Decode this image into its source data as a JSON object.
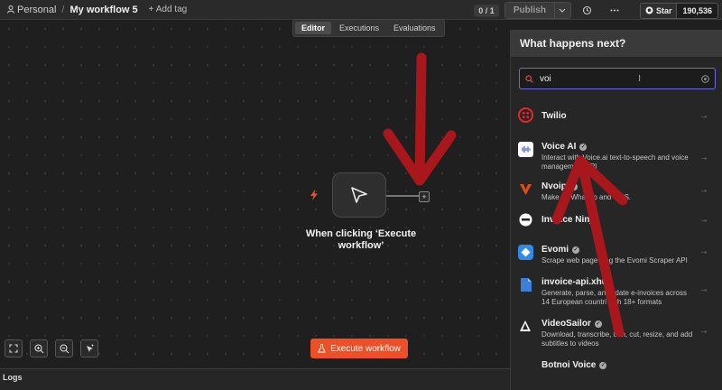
{
  "header": {
    "project": "Personal",
    "separator": "/",
    "workflow_name": "My workflow 5",
    "add_tag": "+ Add tag",
    "counter": "0 / 1",
    "publish": "Publish",
    "github_star": "Star",
    "github_count": "190,536"
  },
  "tabs": [
    "Editor",
    "Executions",
    "Evaluations"
  ],
  "canvas": {
    "trigger_label": "When clicking ‘Execute workflow’",
    "execute_button": "Execute workflow",
    "logs": "Logs"
  },
  "panel": {
    "title": "What happens next?",
    "search_value": "voi",
    "items": [
      {
        "name": "Twilio",
        "desc": "",
        "verified": false,
        "icon_color": "#e5262e",
        "icon": "twilio-icon"
      },
      {
        "name": "Voice AI",
        "desc": "Interact with Voice.ai text-to-speech and voice management API",
        "verified": true,
        "icon_color": "#ffffff",
        "icon": "voice-ai-icon"
      },
      {
        "name": "Nvoip",
        "desc": "Make ca         Whats    p and SMS.",
        "verified": true,
        "icon_color": "#e64b16",
        "icon": "nvoip-icon"
      },
      {
        "name": "Invoice Ninja",
        "desc": "",
        "verified": false,
        "icon_color": "#ffffff",
        "icon": "invoice-ninja-icon"
      },
      {
        "name": "Evomi",
        "desc": "Scrape web page    sing the Evomi Scraper API",
        "verified": true,
        "icon_color": "#2f8ae8",
        "icon": "evomi-icon"
      },
      {
        "name": "invoice-api.xhub",
        "desc": "Generate, parse, and    lidate e-invoices across 14 European countri    with 18+ formats",
        "verified": false,
        "icon_color": "#3b7fd6",
        "icon": "document-icon"
      },
      {
        "name": "VideoSailor",
        "desc": "Download, transcribe, trim, cut, resize, and add subtitles to videos",
        "verified": true,
        "icon_color": "#ffffff",
        "icon": "videosailor-icon"
      },
      {
        "name": "Botnoi Voice",
        "desc": "",
        "verified": true,
        "icon_color": "#9a9a9a",
        "icon": "botnoi-icon"
      }
    ]
  },
  "colors": {
    "accent": "#ee4f27",
    "search_border": "#6b6bdf",
    "annotation": "#a8171c"
  }
}
